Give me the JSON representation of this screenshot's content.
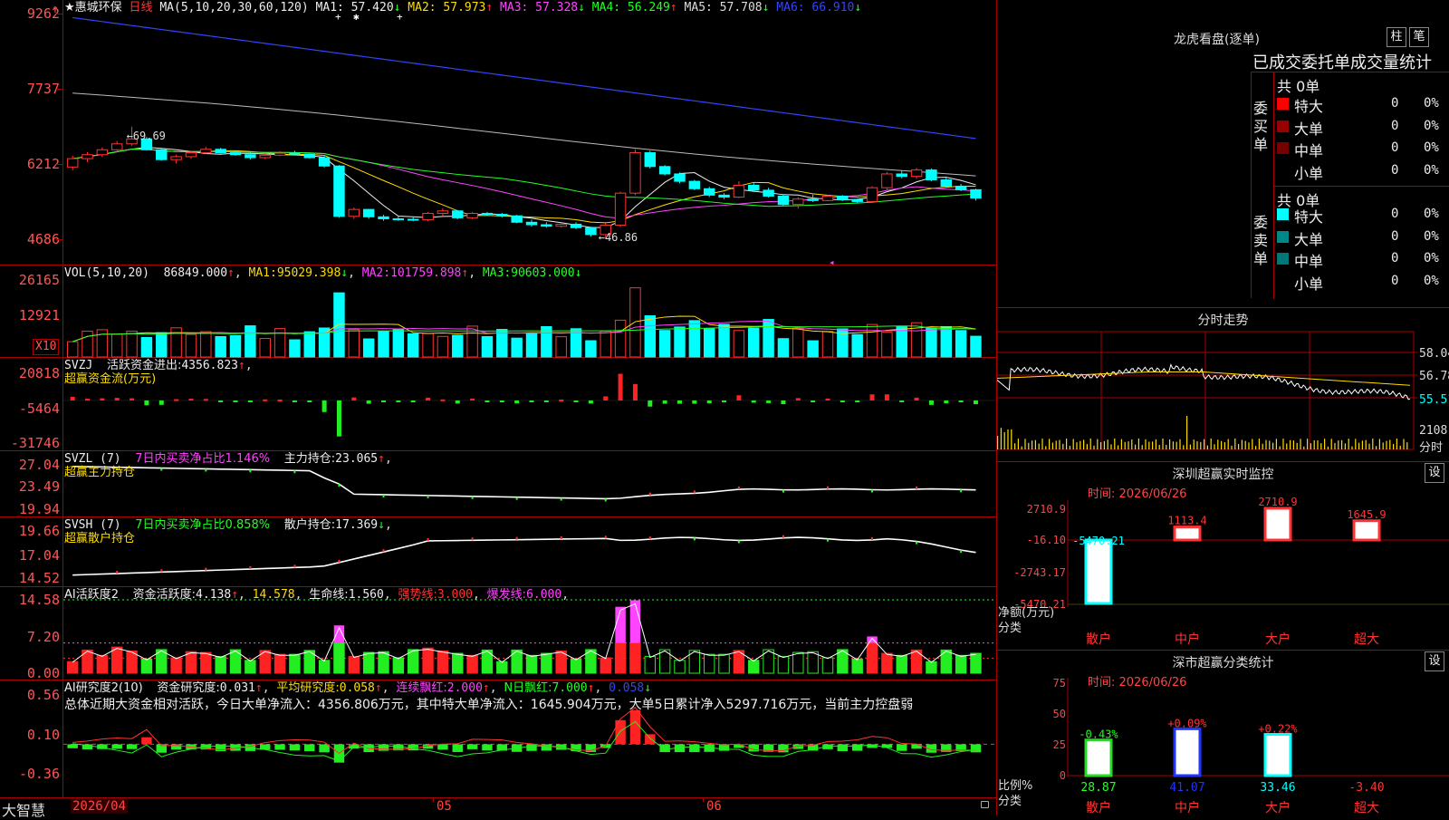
{
  "stock": {
    "name": "惠城环保",
    "period": "日线"
  },
  "price_pane": {
    "ma_header": "MA(5,10,20,30,60,120)",
    "ma": [
      {
        "label": "MA1:",
        "value": "57.420",
        "arrow": "↓",
        "color": "#eeeeee"
      },
      {
        "label": "MA2:",
        "value": "57.973",
        "arrow": "↑",
        "color": "#ffdd00"
      },
      {
        "label": "MA3:",
        "value": "57.328",
        "arrow": "↓",
        "color": "#ff44ff"
      },
      {
        "label": "MA4:",
        "value": "56.249",
        "arrow": "↑",
        "color": "#22ff22"
      },
      {
        "label": "MA5:",
        "value": "57.708",
        "arrow": "↓",
        "color": "#dddddd"
      },
      {
        "label": "MA6:",
        "value": "66.910",
        "arrow": "↓",
        "color": "#3344ff"
      }
    ],
    "y_ticks": [
      "9262",
      "7737",
      "6212",
      "4686"
    ],
    "high_note": "69.69",
    "low_note": "46.86"
  },
  "vol_pane": {
    "header": "VOL(5,10,20)",
    "value": "86849.000",
    "ma1": "95029.398",
    "ma2": "101759.898",
    "ma3": "90603.000",
    "y_ticks": [
      "26165",
      "12921"
    ],
    "unit": "X10"
  },
  "svzj_pane": {
    "header": "SVZJ",
    "label": "活跃资金进出:",
    "value": "4356.823",
    "sub": "超赢资金流(万元)",
    "y_ticks": [
      "20818",
      "-5464",
      "-31746"
    ]
  },
  "svzl_pane": {
    "header": "SVZL (7)",
    "ratio": "7日内买卖净占比1.146%",
    "label": "主力持仓:",
    "value": "23.065",
    "sub": "超赢主力持仓",
    "y_ticks": [
      "27.04",
      "23.49",
      "19.94"
    ]
  },
  "svsh_pane": {
    "header": "SVSH (7)",
    "ratio": "7日内买卖净占比0.858%",
    "label": "散户持仓:",
    "value": "17.369",
    "sub": "超赢散户持仓",
    "y_ticks": [
      "19.66",
      "17.04",
      "14.52"
    ]
  },
  "ai_active_pane": {
    "header": "AI活跃度2",
    "label": "资金活跃度:",
    "value": "4.138",
    "v2": "14.578",
    "life_label": "生命线:",
    "life": "1.560",
    "strong_label": "强势线:",
    "strong": "3.000",
    "burst_label": "爆发线:",
    "burst": "6.000",
    "y_ticks": [
      "14.58",
      "7.20",
      "0.00"
    ]
  },
  "ai_research_pane": {
    "header": "AI研究度2(10)",
    "label": "资金研究度:",
    "value": "0.031",
    "avg_label": "平均研究度:",
    "avg": "0.058",
    "cont_label": "连续飘红:",
    "cont": "2.000",
    "nday_label": "N日飘红:",
    "nday": "7.000",
    "last": "0.058",
    "summary": "总体近期大资金相对活跃，今日大单净流入：4356.806万元，其中特大单净流入：1645.904万元，大单5日累计净入5297.716万元，当前主力控盘弱",
    "y_ticks": [
      "0.56",
      "0.10",
      "-0.36"
    ]
  },
  "x_axis": {
    "labels": [
      "2026/04",
      "05",
      "06"
    ],
    "brand": "大智慧"
  },
  "right_panel": {
    "dragon_title": "龙虎看盘(逐单)",
    "btn_bar": "柱",
    "btn_pen": "笔",
    "stat_title": "已成交委托单成交量统计",
    "buy_label": "委买单",
    "sell_label": "委卖单",
    "buy_total": "共 0单",
    "sell_total": "共 0单",
    "buy_rows": [
      {
        "name": "特大",
        "count": "0",
        "pct": "0%",
        "color": "#ff0000"
      },
      {
        "name": "大单",
        "count": "0",
        "pct": "0%",
        "color": "#990000"
      },
      {
        "name": "中单",
        "count": "0",
        "pct": "0%",
        "color": "#770000"
      },
      {
        "name": "小单",
        "count": "0",
        "pct": "0%",
        "color": ""
      }
    ],
    "sell_rows": [
      {
        "name": "特大",
        "count": "0",
        "pct": "0%",
        "color": "#00ffff"
      },
      {
        "name": "大单",
        "count": "0",
        "pct": "0%",
        "color": "#008888"
      },
      {
        "name": "中单",
        "count": "0",
        "pct": "0%",
        "color": "#007777"
      },
      {
        "name": "小单",
        "count": "0",
        "pct": "0%",
        "color": ""
      }
    ],
    "intraday_title": "分时走势",
    "intraday_ticks": [
      "58.04",
      "56.78",
      "55.51"
    ],
    "intraday_vol": "2108",
    "intraday_vol_label": "分时",
    "sz_monitor_title": "深圳超赢实时监控",
    "sz_set": "设",
    "sz_time": "时间: 2026/06/26",
    "sz_y_ticks": [
      "2710.9",
      "-16.10",
      "-2743.17",
      "-5470.21"
    ],
    "sz_bars": [
      {
        "cat": "散户",
        "value": "-5470.21"
      },
      {
        "cat": "中户",
        "value": "1113.4"
      },
      {
        "cat": "大户",
        "value": "2710.9"
      },
      {
        "cat": "超大",
        "value": "1645.9"
      }
    ],
    "sz_left_label1": "净额(万元)",
    "sz_left_label2": "分类",
    "cls_title": "深市超赢分类统计",
    "cls_set": "设",
    "cls_time": "时间: 2026/06/26",
    "cls_y_ticks": [
      "75",
      "50",
      "25",
      "0"
    ],
    "cls_bars": [
      {
        "cat": "散户",
        "pct": "28.87",
        "chg": "-0.43%"
      },
      {
        "cat": "中户",
        "pct": "41.07",
        "chg": "+0.09%"
      },
      {
        "cat": "大户",
        "pct": "33.46",
        "chg": "+0.22%"
      },
      {
        "cat": "超大",
        "pct": "-3.40",
        "chg": ""
      }
    ],
    "cls_left_label1": "比例%",
    "cls_left_label2": "分类"
  },
  "chart_data": [
    {
      "type": "candlestick",
      "title": "惠城环保 日线",
      "ylim": [
        46.86,
        92.62
      ],
      "candles": [
        [
          61.5,
          63.8,
          60.8,
          63.2
        ],
        [
          63.2,
          64.5,
          62.5,
          64.0
        ],
        [
          64.0,
          65.5,
          63.5,
          65.0
        ],
        [
          65.0,
          66.8,
          64.6,
          66.2
        ],
        [
          66.2,
          69.7,
          65.8,
          67.2
        ],
        [
          67.2,
          67.6,
          64.8,
          65.0
        ],
        [
          65.0,
          65.2,
          62.8,
          63.0
        ],
        [
          63.0,
          64.0,
          62.2,
          63.6
        ],
        [
          63.6,
          64.8,
          63.2,
          64.4
        ],
        [
          64.4,
          65.6,
          64.1,
          65.1
        ],
        [
          65.1,
          65.4,
          64.2,
          64.4
        ],
        [
          64.4,
          64.9,
          63.8,
          64.0
        ],
        [
          64.0,
          64.5,
          63.0,
          63.4
        ],
        [
          63.4,
          64.2,
          63.1,
          63.9
        ],
        [
          63.9,
          64.7,
          63.7,
          64.3
        ],
        [
          64.3,
          64.8,
          63.8,
          64.1
        ],
        [
          64.1,
          64.2,
          63.2,
          63.4
        ],
        [
          63.4,
          63.8,
          61.4,
          61.7
        ],
        [
          61.7,
          61.9,
          51.2,
          51.5
        ],
        [
          51.5,
          53.3,
          51.0,
          52.9
        ],
        [
          52.9,
          53.0,
          51.0,
          51.4
        ],
        [
          51.4,
          51.8,
          50.6,
          51.0
        ],
        [
          51.0,
          51.5,
          50.6,
          50.9
        ],
        [
          50.9,
          51.3,
          50.5,
          50.8
        ],
        [
          50.8,
          52.4,
          50.5,
          52.1
        ],
        [
          52.1,
          53.1,
          51.5,
          52.6
        ],
        [
          52.6,
          52.8,
          50.9,
          51.2
        ],
        [
          51.2,
          52.4,
          50.9,
          52.1
        ],
        [
          52.1,
          52.4,
          51.6,
          51.9
        ],
        [
          51.9,
          52.2,
          51.3,
          51.6
        ],
        [
          51.6,
          51.8,
          50.1,
          50.3
        ],
        [
          50.3,
          50.8,
          49.4,
          49.8
        ],
        [
          49.8,
          50.3,
          49.2,
          49.5
        ],
        [
          49.5,
          50.2,
          49.2,
          49.9
        ],
        [
          49.9,
          50.3,
          48.9,
          49.2
        ],
        [
          49.2,
          49.4,
          47.4,
          47.8
        ],
        [
          47.8,
          50.1,
          46.86,
          49.7
        ],
        [
          49.7,
          56.5,
          49.3,
          56.2
        ],
        [
          56.2,
          65.1,
          55.8,
          64.4
        ],
        [
          64.4,
          64.8,
          61.2,
          61.6
        ],
        [
          61.6,
          61.9,
          59.8,
          60.1
        ],
        [
          60.1,
          60.4,
          58.2,
          58.6
        ],
        [
          58.6,
          58.9,
          56.8,
          57.1
        ],
        [
          57.1,
          57.5,
          55.4,
          55.8
        ],
        [
          55.8,
          56.2,
          55.0,
          55.4
        ],
        [
          55.4,
          58.6,
          55.2,
          57.8
        ],
        [
          57.8,
          58.4,
          56.4,
          56.8
        ],
        [
          56.8,
          57.3,
          55.3,
          55.6
        ],
        [
          55.6,
          56.0,
          53.6,
          53.9
        ],
        [
          53.9,
          55.4,
          53.1,
          55.0
        ],
        [
          55.0,
          55.9,
          54.4,
          54.7
        ],
        [
          54.7,
          55.9,
          54.6,
          55.6
        ],
        [
          55.6,
          55.8,
          54.6,
          54.9
        ],
        [
          54.9,
          55.1,
          54.1,
          54.5
        ],
        [
          54.5,
          57.6,
          54.2,
          57.3
        ],
        [
          57.3,
          60.5,
          56.7,
          60.1
        ],
        [
          60.1,
          60.8,
          59.2,
          59.6
        ],
        [
          59.6,
          61.3,
          59.1,
          60.9
        ],
        [
          60.9,
          61.2,
          58.6,
          58.9
        ],
        [
          58.9,
          59.3,
          57.3,
          57.6
        ],
        [
          57.6,
          58.1,
          56.6,
          56.9
        ],
        [
          56.9,
          57.1,
          54.7,
          55.2
        ]
      ],
      "ma_lines": {
        "MA1": "57.420",
        "MA2": "57.973",
        "MA3": "57.328",
        "MA4": "56.249",
        "MA5": "57.708",
        "MA6": "66.910"
      }
    }
  ]
}
